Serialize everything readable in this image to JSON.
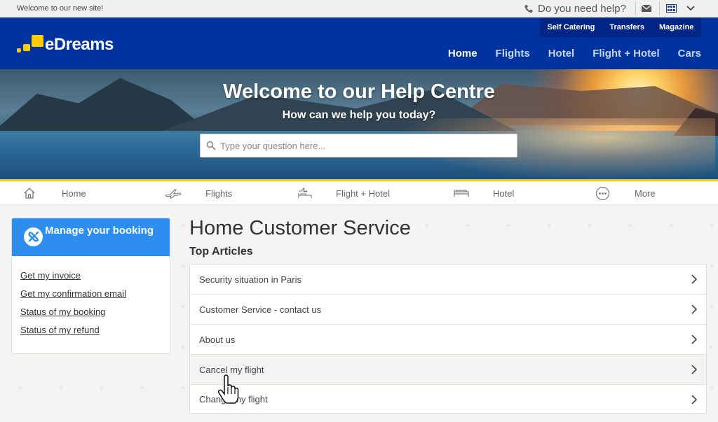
{
  "topbar": {
    "welcome": "Welcome to our new site!",
    "help": "Do you need help?",
    "icons": [
      "phone-icon",
      "mail-icon",
      "flag-icon",
      "chevron-down-icon"
    ]
  },
  "header": {
    "brand": "eDreams",
    "subnav": [
      "Self Catering",
      "Transfers",
      "Magazine"
    ],
    "mainnav": [
      "Home",
      "Flights",
      "Hotel",
      "Flight + Hotel",
      "Cars"
    ],
    "active_nav": "Home"
  },
  "hero": {
    "title": "Welcome to our Help Centre",
    "subtitle": "How can we help you today?",
    "search_placeholder": "Type your question here..."
  },
  "categories": [
    {
      "label": "Home",
      "icon": "home-icon"
    },
    {
      "label": "Flights",
      "icon": "plane-icon"
    },
    {
      "label": "Flight + Hotel",
      "icon": "flight-hotel-icon"
    },
    {
      "label": "Hotel",
      "icon": "bed-icon"
    },
    {
      "label": "More",
      "icon": "more-icon"
    }
  ],
  "sidebar": {
    "title": "Manage your booking",
    "links": [
      "Get my invoice",
      "Get my confirmation email",
      "Status of my booking",
      "Status of my refund"
    ]
  },
  "main": {
    "title": "Home Customer Service",
    "subtitle": "Top Articles",
    "articles": [
      "Security situation in Paris",
      "Customer Service - contact us",
      "About us",
      "Cancel my flight",
      "Change my flight"
    ]
  },
  "colors": {
    "brand_blue": "#0033a0",
    "accent_yellow": "#ffcc00",
    "card_blue": "#2d8ef0"
  }
}
